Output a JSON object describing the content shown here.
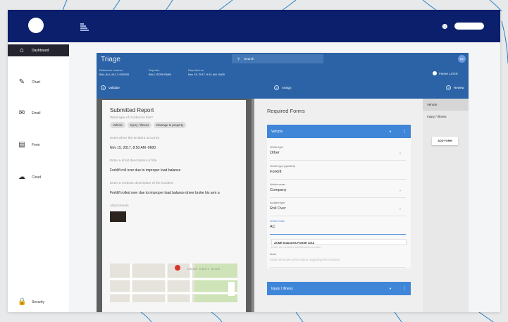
{
  "sidebar": {
    "items": [
      {
        "label": "Dashboard",
        "icon": "home-icon"
      },
      {
        "label": "Chart",
        "icon": "chart-icon"
      },
      {
        "label": "Email",
        "icon": "email-icon"
      },
      {
        "label": "Form",
        "icon": "form-icon"
      },
      {
        "label": "Cloud",
        "icon": "cloud-icon"
      },
      {
        "label": "Security",
        "icon": "lock-icon"
      }
    ]
  },
  "triage": {
    "title": "Triage",
    "search_placeholder": "Search",
    "avatar": "BK",
    "meta": [
      {
        "label": "Reference number",
        "value": "BAL-ALL-IN-17-000028"
      },
      {
        "label": "Reporter",
        "value": "BALL SCRKOMIN"
      },
      {
        "label": "Reported on",
        "value": "Nov 15, 2017, 9:51 AM -0600"
      }
    ],
    "finish_later": "FINISH LATER",
    "steps": [
      {
        "num": "1",
        "label": "Validate"
      },
      {
        "num": "2",
        "label": "Assign"
      },
      {
        "num": "3",
        "label": "Review"
      }
    ]
  },
  "report": {
    "title": "Submitted Report",
    "q_type": "What type of incident is this?",
    "chips": [
      "Vehicle",
      "Injury / Illness",
      "Damage to property"
    ],
    "q_when": "Enter when the incident occurred",
    "when": "Nov 15, 2017, 8:50 AM -0600",
    "q_short": "Enter a short description or title",
    "short": "Forklift roll over due to improper load balance",
    "q_verbose": "Enter a verbose description of the incident",
    "verbose": "Forklift rolled over due to improper load balance driver broke his arm a",
    "attachments": "Attachments",
    "map_label": "NEAR EAST SIDE"
  },
  "forms": {
    "title": "Required Forms",
    "vehicle_header": "Vehicle",
    "injury_header": "Injury / Illness",
    "fields": [
      {
        "label": "Vehicle type",
        "value": "Other"
      },
      {
        "label": "Vehicle type (specified)",
        "value": "Forklift"
      },
      {
        "label": "Vehicle owner",
        "value": "Company"
      },
      {
        "label": "Accident type",
        "value": "Roll Over"
      },
      {
        "label": "Vehicle make",
        "value": "AC"
      }
    ],
    "suggestion": "ACME Industries Forklift 110A",
    "hint": "Enter the vehicle's identification number",
    "notes_label": "Notes",
    "notes_placeholder": "Enter all known information regarding the incident"
  },
  "side": {
    "tabs": [
      "Vehicle",
      "Injury / Illness"
    ],
    "add_form": "ADD FORM"
  }
}
